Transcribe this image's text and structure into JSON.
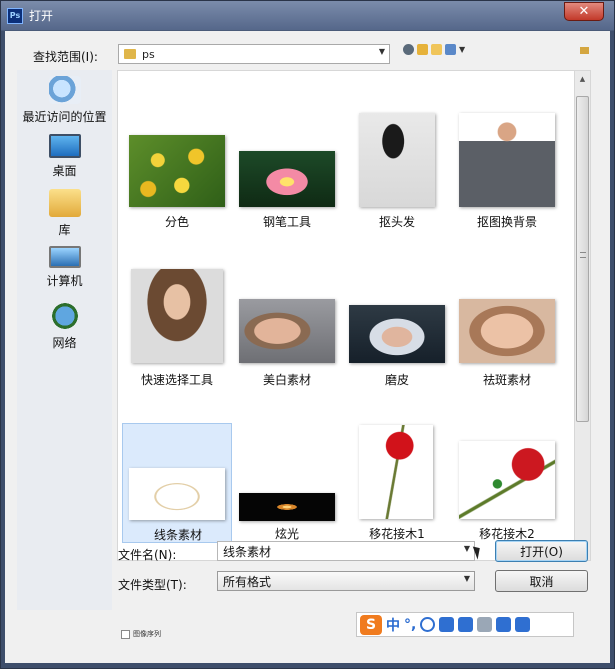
{
  "window": {
    "app_icon_text": "Ps",
    "title": "打开",
    "close_glyph": "✕"
  },
  "header": {
    "look_in_label": "查找范围(I):",
    "location": "ps",
    "toolbar_icons": [
      "back-icon",
      "up-folder-icon",
      "new-folder-icon",
      "view-menu-icon"
    ]
  },
  "places": [
    {
      "label": "最近访问的位置",
      "icon": "recent-places-icon"
    },
    {
      "label": "桌面",
      "icon": "desktop-icon"
    },
    {
      "label": "库",
      "icon": "library-icon"
    },
    {
      "label": "计算机",
      "icon": "computer-icon"
    },
    {
      "label": "网络",
      "icon": "network-icon"
    }
  ],
  "files": [
    {
      "name": "分色",
      "thumb": "yellow-roses",
      "selected": false
    },
    {
      "name": "钢笔工具",
      "thumb": "lotus-flower",
      "selected": false
    },
    {
      "name": "抠头发",
      "thumb": "woman-flying-hair",
      "selected": false
    },
    {
      "name": "抠图换背景",
      "thumb": "man-in-suit",
      "selected": false
    },
    {
      "name": "快速选择工具",
      "thumb": "woman-curly-hair",
      "selected": false
    },
    {
      "name": "美白素材",
      "thumb": "woman-portrait",
      "selected": false
    },
    {
      "name": "磨皮",
      "thumb": "woman-hood",
      "selected": false
    },
    {
      "name": "祛斑素材",
      "thumb": "woman-closeup",
      "selected": false
    },
    {
      "name": "线条素材",
      "thumb": "line-art",
      "selected": true
    },
    {
      "name": "炫光",
      "thumb": "light-flare",
      "selected": false
    },
    {
      "name": "移花接木1",
      "thumb": "red-rose-1",
      "selected": false
    },
    {
      "name": "移花接木2",
      "thumb": "red-rose-2",
      "selected": false
    }
  ],
  "footer": {
    "filename_label": "文件名(N):",
    "filename_value": "线条素材",
    "filetype_label": "文件类型(T):",
    "filetype_value": "所有格式",
    "open_label": "打开(O)",
    "cancel_label": "取消",
    "image_sequence_label": "图像序列"
  },
  "ime": {
    "logo": "S",
    "items": [
      "中",
      "°,"
    ]
  },
  "colors": {
    "title_bar": "#55678a",
    "close_button": "#c2392a",
    "selection": "#dbeafc"
  }
}
